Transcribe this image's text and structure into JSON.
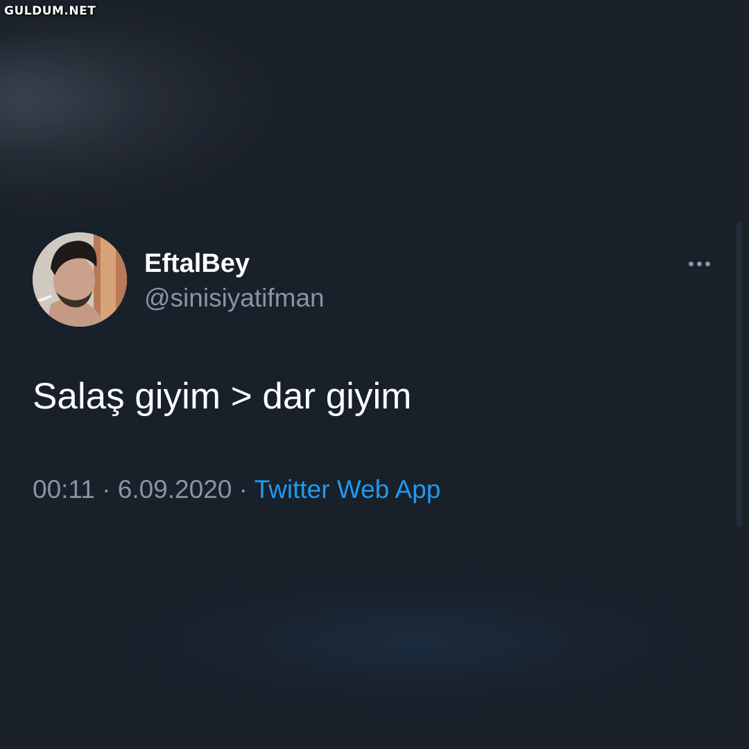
{
  "watermark": {
    "text": "GULDUM.NET"
  },
  "tweet": {
    "display_name": "EftalBey",
    "handle": "@sinisiyatifman",
    "text": "Salaş giyim > dar giyim",
    "time": "00:11",
    "separator": "·",
    "date": "6.09.2020",
    "source": "Twitter Web App",
    "more_icon": "more-horizontal-icon"
  },
  "colors": {
    "background": "#1b212b",
    "card": "#18202a",
    "text_primary": "#ffffff",
    "text_secondary": "#8a95a2",
    "link": "#1d9bf0"
  }
}
